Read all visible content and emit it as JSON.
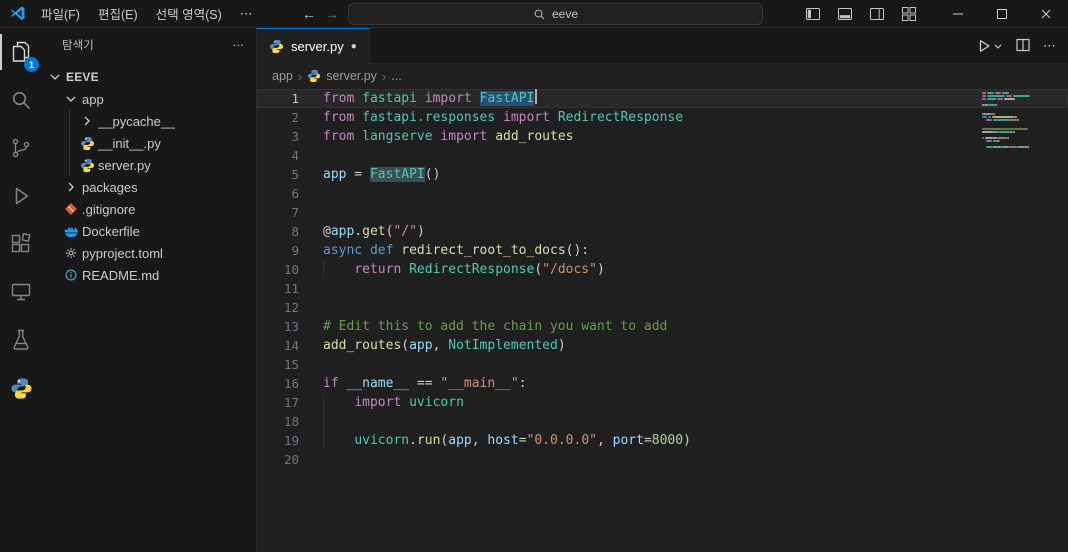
{
  "colors": {
    "kw": "#C586C0",
    "kw2": "#569CD6",
    "cls": "#4EC9B0",
    "mod": "#4EC9B0",
    "fn": "#DCDCAA",
    "str": "#CE9178",
    "num": "#B5CEA8",
    "var": "#9CDCFE",
    "par": "#9CDCFE",
    "pln": "#CCCCCC",
    "com": "#6A9955",
    "sel": "#264F78",
    "occ": "#3A4E56",
    "accent": "#0078D4"
  },
  "icons": {
    "modified_dot": "●",
    "breadcrumb_separator": "›",
    "ellipsis": "⋯"
  },
  "titlebar": {
    "menus": [
      "파일(F)",
      "편집(E)",
      "선택 영역(S)"
    ],
    "menu_overflow": "⋯",
    "search_value": "eeve"
  },
  "activity_bar": {
    "items": [
      {
        "name": "explorer",
        "badge": "1",
        "active": true
      },
      {
        "name": "search"
      },
      {
        "name": "source-control"
      },
      {
        "name": "run-and-debug"
      },
      {
        "name": "extensions"
      },
      {
        "name": "remote-explorer"
      },
      {
        "name": "testing"
      },
      {
        "name": "python"
      }
    ]
  },
  "sidebar": {
    "title": "탐색기",
    "root_label": "EEVE",
    "tree": [
      {
        "label": "EEVE",
        "type": "root",
        "indent": 0,
        "chevron": "open"
      },
      {
        "label": "app",
        "type": "folder",
        "indent": 1,
        "chevron": "open"
      },
      {
        "label": "__pycache__",
        "type": "folder",
        "indent": 2,
        "chevron": "closed"
      },
      {
        "label": "__init__.py",
        "type": "python",
        "indent": 2
      },
      {
        "label": "server.py",
        "type": "python",
        "indent": 2
      },
      {
        "label": "packages",
        "type": "folder",
        "indent": 1,
        "chevron": "closed"
      },
      {
        "label": ".gitignore",
        "type": "git",
        "indent": 1
      },
      {
        "label": "Dockerfile",
        "type": "docker",
        "indent": 1
      },
      {
        "label": "pyproject.toml",
        "type": "gear",
        "indent": 1
      },
      {
        "label": "README.md",
        "type": "info",
        "indent": 1
      }
    ]
  },
  "editor": {
    "tab": {
      "label": "server.py",
      "modified": true
    },
    "breadcrumb": {
      "root": "app",
      "file": "server.py",
      "more": "..."
    },
    "code": {
      "language": "python",
      "lines": [
        {
          "n": 1,
          "current": true,
          "cursor": true,
          "tokens": [
            [
              "kw",
              "from"
            ],
            [
              "pln",
              " "
            ],
            [
              "mod",
              "fastapi"
            ],
            [
              "pln",
              " "
            ],
            [
              "kw",
              "import"
            ],
            [
              "pln",
              " "
            ],
            [
              "cls sel",
              "FastAPI"
            ]
          ]
        },
        {
          "n": 2,
          "tokens": [
            [
              "kw",
              "from"
            ],
            [
              "pln",
              " "
            ],
            [
              "mod",
              "fastapi.responses"
            ],
            [
              "pln",
              " "
            ],
            [
              "kw",
              "import"
            ],
            [
              "pln",
              " "
            ],
            [
              "cls",
              "RedirectResponse"
            ]
          ]
        },
        {
          "n": 3,
          "tokens": [
            [
              "kw",
              "from"
            ],
            [
              "pln",
              " "
            ],
            [
              "mod",
              "langserve"
            ],
            [
              "pln",
              " "
            ],
            [
              "kw",
              "import"
            ],
            [
              "pln",
              " "
            ],
            [
              "fn",
              "add_routes"
            ]
          ]
        },
        {
          "n": 4,
          "tokens": []
        },
        {
          "n": 5,
          "tokens": [
            [
              "var",
              "app"
            ],
            [
              "pln",
              " = "
            ],
            [
              "cls occ",
              "FastAPI"
            ],
            [
              "pln",
              "()"
            ]
          ]
        },
        {
          "n": 6,
          "tokens": []
        },
        {
          "n": 7,
          "tokens": []
        },
        {
          "n": 8,
          "tokens": [
            [
              "pln",
              "@"
            ],
            [
              "var",
              "app"
            ],
            [
              "pln",
              "."
            ],
            [
              "fn",
              "get"
            ],
            [
              "pln",
              "("
            ],
            [
              "str",
              "\"/\""
            ],
            [
              "pln",
              ")"
            ]
          ]
        },
        {
          "n": 9,
          "tokens": [
            [
              "kw2",
              "async"
            ],
            [
              "pln",
              " "
            ],
            [
              "kw2",
              "def"
            ],
            [
              "pln",
              " "
            ],
            [
              "fn",
              "redirect_root_to_docs"
            ],
            [
              "pln",
              "():"
            ]
          ]
        },
        {
          "n": 10,
          "guide": true,
          "tokens": [
            [
              "pln",
              "    "
            ],
            [
              "kw",
              "return"
            ],
            [
              "pln",
              " "
            ],
            [
              "cls",
              "RedirectResponse"
            ],
            [
              "pln",
              "("
            ],
            [
              "str",
              "\"/docs\""
            ],
            [
              "pln",
              ")"
            ]
          ]
        },
        {
          "n": 11,
          "tokens": []
        },
        {
          "n": 12,
          "tokens": []
        },
        {
          "n": 13,
          "tokens": [
            [
              "com",
              "# Edit this to add the chain you want to add"
            ]
          ]
        },
        {
          "n": 14,
          "tokens": [
            [
              "fn",
              "add_routes"
            ],
            [
              "pln",
              "("
            ],
            [
              "var",
              "app"
            ],
            [
              "pln",
              ", "
            ],
            [
              "cls",
              "NotImplemented"
            ],
            [
              "pln",
              ")"
            ]
          ]
        },
        {
          "n": 15,
          "tokens": []
        },
        {
          "n": 16,
          "tokens": [
            [
              "kw",
              "if"
            ],
            [
              "pln",
              " "
            ],
            [
              "var",
              "__name__"
            ],
            [
              "pln",
              " == "
            ],
            [
              "str",
              "\"__main__\""
            ],
            [
              "pln",
              ":"
            ]
          ]
        },
        {
          "n": 17,
          "guide": true,
          "tokens": [
            [
              "pln",
              "    "
            ],
            [
              "kw",
              "import"
            ],
            [
              "pln",
              " "
            ],
            [
              "mod",
              "uvicorn"
            ]
          ]
        },
        {
          "n": 18,
          "guide": true,
          "tokens": []
        },
        {
          "n": 19,
          "guide": true,
          "tokens": [
            [
              "pln",
              "    "
            ],
            [
              "mod",
              "uvicorn"
            ],
            [
              "pln",
              "."
            ],
            [
              "fn",
              "run"
            ],
            [
              "pln",
              "("
            ],
            [
              "var",
              "app"
            ],
            [
              "pln",
              ", "
            ],
            [
              "par",
              "host"
            ],
            [
              "pln",
              "="
            ],
            [
              "str",
              "\"0.0.0.0\""
            ],
            [
              "pln",
              ", "
            ],
            [
              "par",
              "port"
            ],
            [
              "pln",
              "="
            ],
            [
              "num",
              "8000"
            ],
            [
              "pln",
              ")"
            ]
          ]
        },
        {
          "n": 20,
          "tokens": []
        }
      ]
    }
  }
}
